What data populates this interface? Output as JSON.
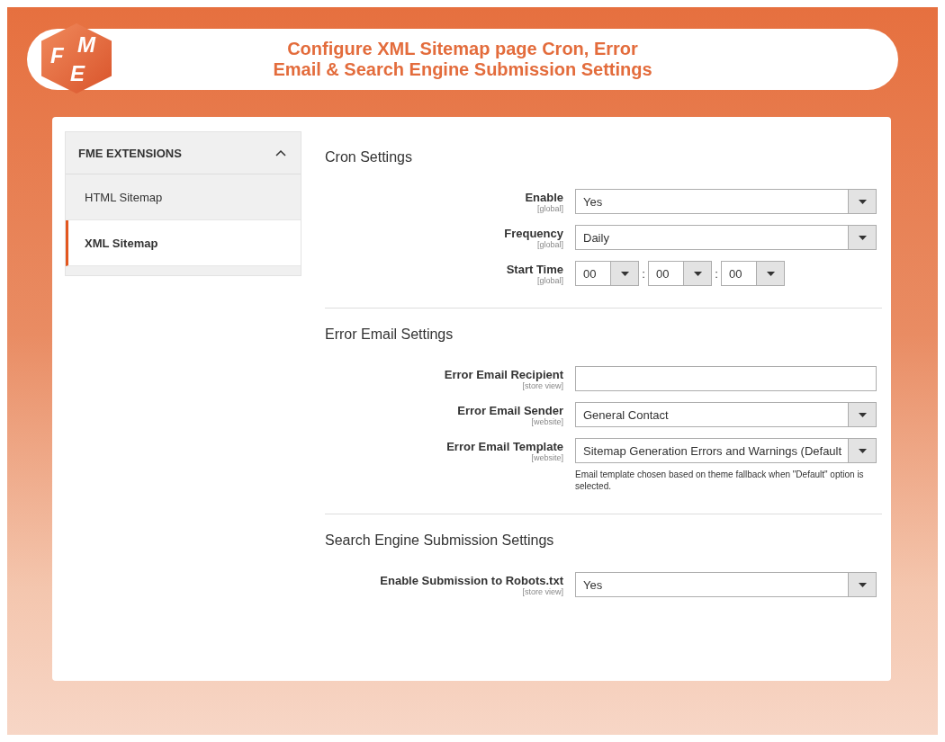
{
  "logo": {
    "letters": [
      "F",
      "M",
      "E"
    ]
  },
  "banner": {
    "title_lines": [
      "Configure XML Sitemap page Cron, Error",
      "Email & Search Engine Submission Settings"
    ]
  },
  "sidebar": {
    "group": {
      "title": "FME EXTENSIONS",
      "expanded": true,
      "items": [
        {
          "label": "HTML Sitemap",
          "selected": false
        },
        {
          "label": "XML Sitemap",
          "selected": true
        }
      ]
    }
  },
  "sections": [
    {
      "title": "Cron Settings",
      "fields": [
        {
          "kind": "select",
          "label": "Enable",
          "scope": "[global]",
          "value": "Yes"
        },
        {
          "kind": "select",
          "label": "Frequency",
          "scope": "[global]",
          "value": "Daily"
        },
        {
          "kind": "time",
          "label": "Start Time",
          "scope": "[global]",
          "parts": [
            "00",
            "00",
            "00"
          ],
          "separators": [
            ":",
            ":"
          ]
        }
      ]
    },
    {
      "title": "Error Email Settings",
      "fields": [
        {
          "kind": "text",
          "label": "Error Email Recipient",
          "scope": "[store view]"
        },
        {
          "kind": "select",
          "label": "Error Email Sender",
          "scope": "[website]",
          "value": "General Contact"
        },
        {
          "kind": "select",
          "label": "Error Email Template",
          "scope": "[website]",
          "value": "Sitemap Generation Errors and Warnings (Default",
          "note": "Email template chosen based on theme fallback when \"Default\" option is selected."
        }
      ]
    },
    {
      "title": "Search Engine Submission Settings",
      "fields": [
        {
          "kind": "select",
          "label": "Enable Submission to Robots.txt",
          "scope": "[store view]",
          "value": "Yes"
        }
      ]
    }
  ]
}
